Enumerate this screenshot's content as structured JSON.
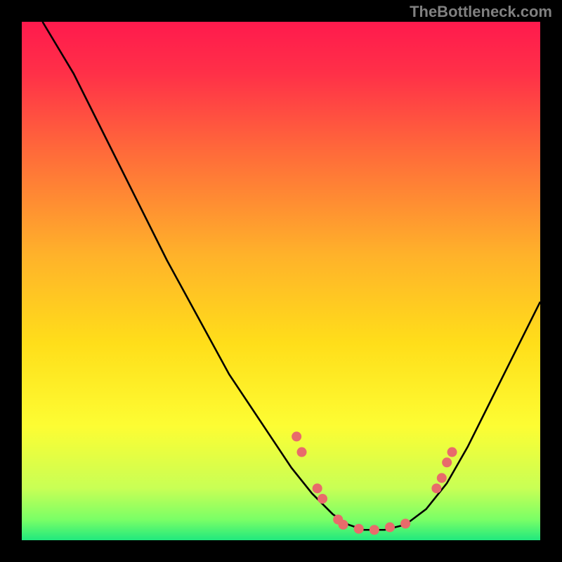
{
  "watermark": "TheBottleneck.com",
  "chart_data": {
    "type": "line",
    "title": "",
    "xlabel": "",
    "ylabel": "",
    "xlim": [
      0,
      100
    ],
    "ylim": [
      0,
      100
    ],
    "background": {
      "type": "vertical-gradient",
      "stops": [
        {
          "pos": 0.0,
          "color": "#ff1a4d"
        },
        {
          "pos": 0.1,
          "color": "#ff3048"
        },
        {
          "pos": 0.25,
          "color": "#ff6a3a"
        },
        {
          "pos": 0.45,
          "color": "#ffb22a"
        },
        {
          "pos": 0.62,
          "color": "#ffde1a"
        },
        {
          "pos": 0.78,
          "color": "#fdfd33"
        },
        {
          "pos": 0.9,
          "color": "#c8ff55"
        },
        {
          "pos": 0.96,
          "color": "#7aff66"
        },
        {
          "pos": 1.0,
          "color": "#20e87e"
        }
      ]
    },
    "series": [
      {
        "name": "curve",
        "color": "#000000",
        "x": [
          4,
          10,
          16,
          22,
          28,
          34,
          40,
          46,
          52,
          56,
          60,
          63,
          66,
          70,
          74,
          78,
          82,
          86,
          90,
          94,
          98,
          100
        ],
        "y": [
          100,
          90,
          78,
          66,
          54,
          43,
          32,
          23,
          14,
          9,
          5,
          3,
          2,
          2,
          3,
          6,
          11,
          18,
          26,
          34,
          42,
          46
        ]
      }
    ],
    "markers": {
      "color": "#e86b6b",
      "radius": 7,
      "points": [
        {
          "x": 53,
          "y": 20
        },
        {
          "x": 54,
          "y": 17
        },
        {
          "x": 57,
          "y": 10
        },
        {
          "x": 58,
          "y": 8
        },
        {
          "x": 61,
          "y": 4
        },
        {
          "x": 62,
          "y": 3
        },
        {
          "x": 65,
          "y": 2.2
        },
        {
          "x": 68,
          "y": 2.0
        },
        {
          "x": 71,
          "y": 2.5
        },
        {
          "x": 74,
          "y": 3.2
        },
        {
          "x": 80,
          "y": 10
        },
        {
          "x": 81,
          "y": 12
        },
        {
          "x": 82,
          "y": 15
        },
        {
          "x": 83,
          "y": 17
        }
      ]
    }
  }
}
